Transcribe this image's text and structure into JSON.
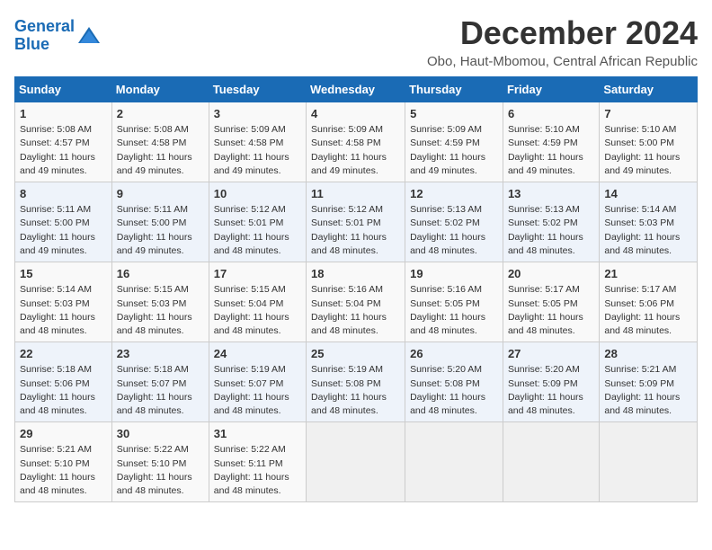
{
  "logo": {
    "line1": "General",
    "line2": "Blue"
  },
  "title": "December 2024",
  "subtitle": "Obo, Haut-Mbomou, Central African Republic",
  "days_of_week": [
    "Sunday",
    "Monday",
    "Tuesday",
    "Wednesday",
    "Thursday",
    "Friday",
    "Saturday"
  ],
  "weeks": [
    [
      {
        "day": "1",
        "info": "Sunrise: 5:08 AM\nSunset: 4:57 PM\nDaylight: 11 hours\nand 49 minutes."
      },
      {
        "day": "2",
        "info": "Sunrise: 5:08 AM\nSunset: 4:58 PM\nDaylight: 11 hours\nand 49 minutes."
      },
      {
        "day": "3",
        "info": "Sunrise: 5:09 AM\nSunset: 4:58 PM\nDaylight: 11 hours\nand 49 minutes."
      },
      {
        "day": "4",
        "info": "Sunrise: 5:09 AM\nSunset: 4:58 PM\nDaylight: 11 hours\nand 49 minutes."
      },
      {
        "day": "5",
        "info": "Sunrise: 5:09 AM\nSunset: 4:59 PM\nDaylight: 11 hours\nand 49 minutes."
      },
      {
        "day": "6",
        "info": "Sunrise: 5:10 AM\nSunset: 4:59 PM\nDaylight: 11 hours\nand 49 minutes."
      },
      {
        "day": "7",
        "info": "Sunrise: 5:10 AM\nSunset: 5:00 PM\nDaylight: 11 hours\nand 49 minutes."
      }
    ],
    [
      {
        "day": "8",
        "info": "Sunrise: 5:11 AM\nSunset: 5:00 PM\nDaylight: 11 hours\nand 49 minutes."
      },
      {
        "day": "9",
        "info": "Sunrise: 5:11 AM\nSunset: 5:00 PM\nDaylight: 11 hours\nand 49 minutes."
      },
      {
        "day": "10",
        "info": "Sunrise: 5:12 AM\nSunset: 5:01 PM\nDaylight: 11 hours\nand 48 minutes."
      },
      {
        "day": "11",
        "info": "Sunrise: 5:12 AM\nSunset: 5:01 PM\nDaylight: 11 hours\nand 48 minutes."
      },
      {
        "day": "12",
        "info": "Sunrise: 5:13 AM\nSunset: 5:02 PM\nDaylight: 11 hours\nand 48 minutes."
      },
      {
        "day": "13",
        "info": "Sunrise: 5:13 AM\nSunset: 5:02 PM\nDaylight: 11 hours\nand 48 minutes."
      },
      {
        "day": "14",
        "info": "Sunrise: 5:14 AM\nSunset: 5:03 PM\nDaylight: 11 hours\nand 48 minutes."
      }
    ],
    [
      {
        "day": "15",
        "info": "Sunrise: 5:14 AM\nSunset: 5:03 PM\nDaylight: 11 hours\nand 48 minutes."
      },
      {
        "day": "16",
        "info": "Sunrise: 5:15 AM\nSunset: 5:03 PM\nDaylight: 11 hours\nand 48 minutes."
      },
      {
        "day": "17",
        "info": "Sunrise: 5:15 AM\nSunset: 5:04 PM\nDaylight: 11 hours\nand 48 minutes."
      },
      {
        "day": "18",
        "info": "Sunrise: 5:16 AM\nSunset: 5:04 PM\nDaylight: 11 hours\nand 48 minutes."
      },
      {
        "day": "19",
        "info": "Sunrise: 5:16 AM\nSunset: 5:05 PM\nDaylight: 11 hours\nand 48 minutes."
      },
      {
        "day": "20",
        "info": "Sunrise: 5:17 AM\nSunset: 5:05 PM\nDaylight: 11 hours\nand 48 minutes."
      },
      {
        "day": "21",
        "info": "Sunrise: 5:17 AM\nSunset: 5:06 PM\nDaylight: 11 hours\nand 48 minutes."
      }
    ],
    [
      {
        "day": "22",
        "info": "Sunrise: 5:18 AM\nSunset: 5:06 PM\nDaylight: 11 hours\nand 48 minutes."
      },
      {
        "day": "23",
        "info": "Sunrise: 5:18 AM\nSunset: 5:07 PM\nDaylight: 11 hours\nand 48 minutes."
      },
      {
        "day": "24",
        "info": "Sunrise: 5:19 AM\nSunset: 5:07 PM\nDaylight: 11 hours\nand 48 minutes."
      },
      {
        "day": "25",
        "info": "Sunrise: 5:19 AM\nSunset: 5:08 PM\nDaylight: 11 hours\nand 48 minutes."
      },
      {
        "day": "26",
        "info": "Sunrise: 5:20 AM\nSunset: 5:08 PM\nDaylight: 11 hours\nand 48 minutes."
      },
      {
        "day": "27",
        "info": "Sunrise: 5:20 AM\nSunset: 5:09 PM\nDaylight: 11 hours\nand 48 minutes."
      },
      {
        "day": "28",
        "info": "Sunrise: 5:21 AM\nSunset: 5:09 PM\nDaylight: 11 hours\nand 48 minutes."
      }
    ],
    [
      {
        "day": "29",
        "info": "Sunrise: 5:21 AM\nSunset: 5:10 PM\nDaylight: 11 hours\nand 48 minutes."
      },
      {
        "day": "30",
        "info": "Sunrise: 5:22 AM\nSunset: 5:10 PM\nDaylight: 11 hours\nand 48 minutes."
      },
      {
        "day": "31",
        "info": "Sunrise: 5:22 AM\nSunset: 5:11 PM\nDaylight: 11 hours\nand 48 minutes."
      },
      {
        "day": "",
        "info": ""
      },
      {
        "day": "",
        "info": ""
      },
      {
        "day": "",
        "info": ""
      },
      {
        "day": "",
        "info": ""
      }
    ]
  ]
}
